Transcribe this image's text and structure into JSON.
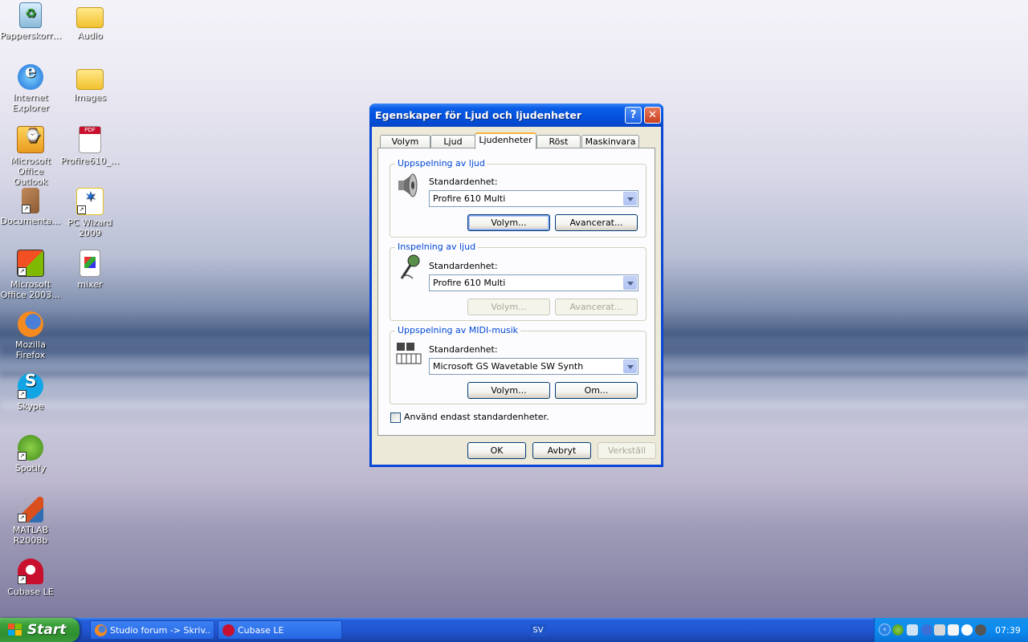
{
  "desktop": {
    "icons": [
      {
        "label": "Papperskorr…",
        "icon": "recycle-bin-icon"
      },
      {
        "label": "Audio",
        "icon": "folder-icon"
      },
      {
        "label": "Internet Explorer",
        "icon": "internet-explorer-icon"
      },
      {
        "label": "Images",
        "icon": "folder-icon"
      },
      {
        "label": "Microsoft Office Outlook",
        "icon": "outlook-icon"
      },
      {
        "label": "Profire610_…",
        "icon": "pdf-icon"
      },
      {
        "label": "Documenta…",
        "icon": "document-icon"
      },
      {
        "label": "PC Wizard 2009",
        "icon": "pc-wizard-icon"
      },
      {
        "label": "Microsoft Office 2003…",
        "icon": "office-icon"
      },
      {
        "label": "mixer",
        "icon": "mixer-icon"
      },
      {
        "label": "Mozilla Firefox",
        "icon": "firefox-icon"
      },
      {
        "label": "Skype",
        "icon": "skype-icon"
      },
      {
        "label": "Spotify",
        "icon": "spotify-icon"
      },
      {
        "label": "MATLAB R2008b",
        "icon": "matlab-icon"
      },
      {
        "label": "Cubase LE",
        "icon": "cubase-icon"
      }
    ]
  },
  "dialog": {
    "title": "Egenskaper för Ljud och ljudenheter",
    "help_glyph": "?",
    "close_glyph": "✕",
    "tabs": [
      "Volym",
      "Ljud",
      "Ljudenheter",
      "Röst",
      "Maskinvara"
    ],
    "active_tab": "Ljudenheter",
    "playback": {
      "group_label": "Uppspelning av ljud",
      "field_label": "Standardenhet:",
      "device": "Profire 610 Multi",
      "volume_button": "Volym...",
      "advanced_button": "Avancerat..."
    },
    "recording": {
      "group_label": "Inspelning av ljud",
      "field_label": "Standardenhet:",
      "device": "Profire 610 Multi",
      "volume_button": "Volym...",
      "advanced_button": "Avancerat..."
    },
    "midi": {
      "group_label": "Uppspelning av MIDI-musik",
      "field_label": "Standardenhet:",
      "device": "Microsoft GS Wavetable SW Synth",
      "volume_button": "Volym...",
      "about_button": "Om..."
    },
    "checkbox_label": "Använd endast standardenheter.",
    "ok_button": "OK",
    "cancel_button": "Avbryt",
    "apply_button": "Verkställ"
  },
  "taskbar": {
    "start_label": "Start",
    "tasks": [
      {
        "label": "Studio forum -> Skriv...",
        "icon": "firefox-icon"
      },
      {
        "label": "Cubase LE",
        "icon": "cubase-icon"
      }
    ],
    "language": "SV",
    "clock": "07:39",
    "chevron": "‹"
  },
  "colors": {
    "titlebar": "#0351dc",
    "taskbar": "#245edb",
    "start_green": "#389e38",
    "group_label": "#0046d5"
  }
}
